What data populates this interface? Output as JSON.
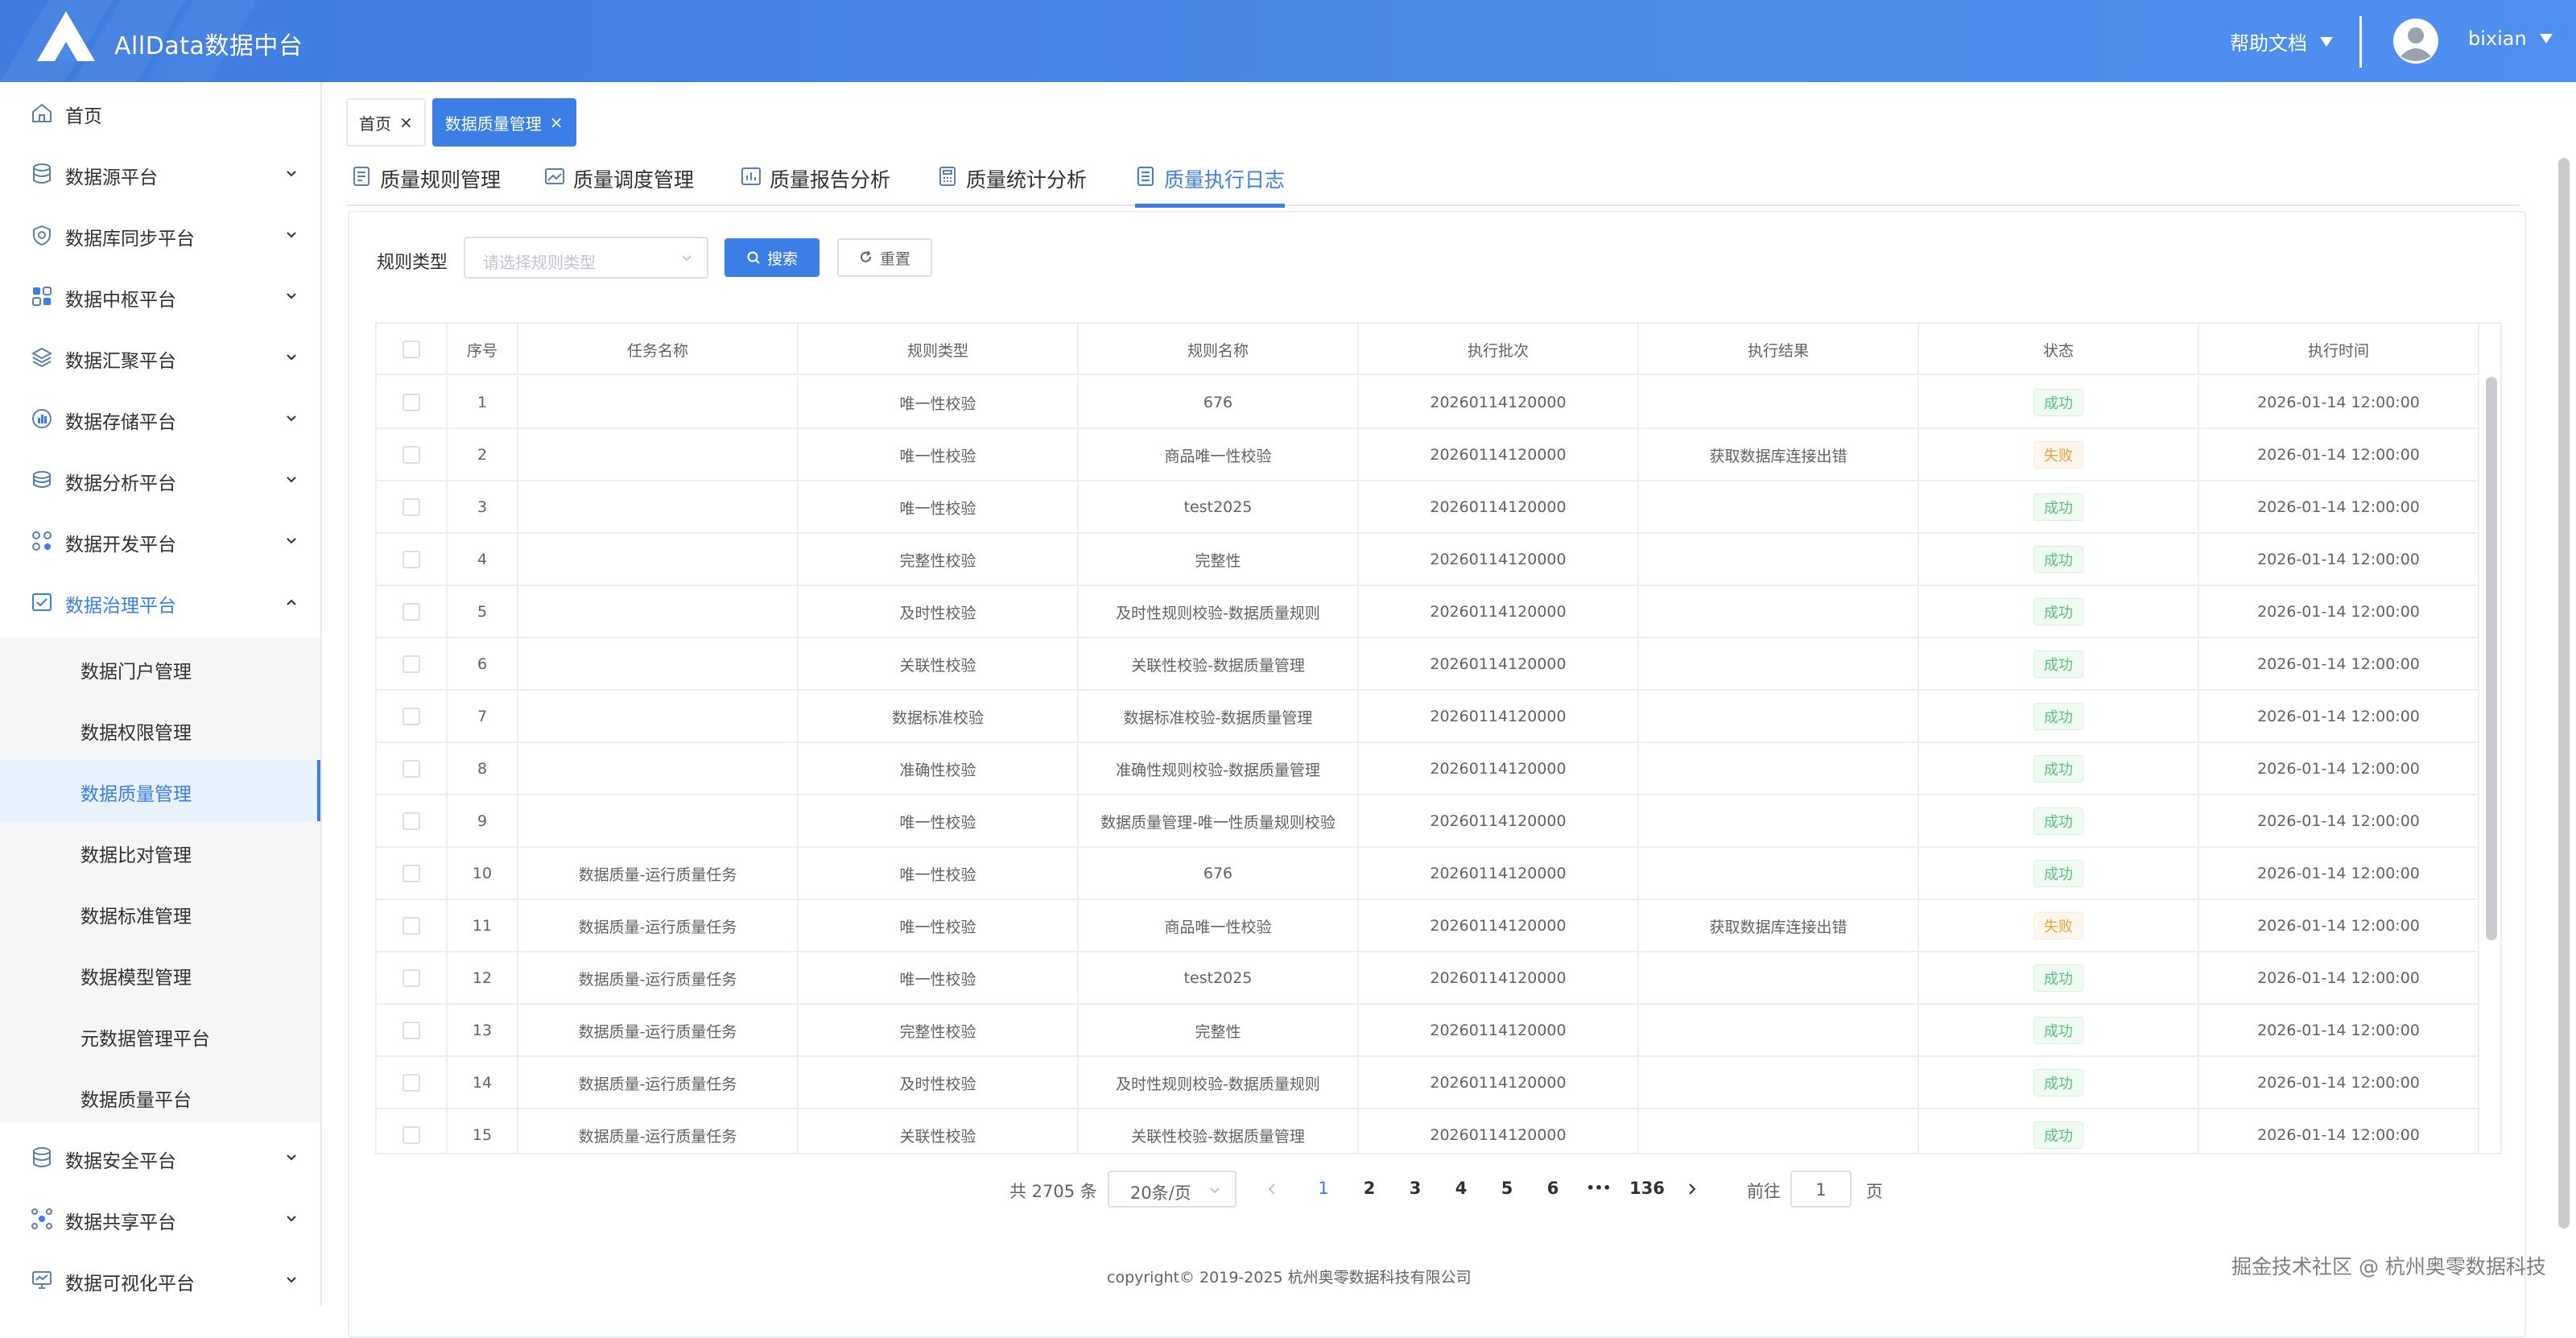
{
  "header": {
    "brand": "AllData数据中台",
    "help": "帮助文档",
    "username": "bixian"
  },
  "sidebar": {
    "items": [
      {
        "label": "首页",
        "icon": "home-icon"
      },
      {
        "label": "数据源平台",
        "icon": "database-icon"
      },
      {
        "label": "数据库同步平台",
        "icon": "sync-icon"
      },
      {
        "label": "数据中枢平台",
        "icon": "grid-icon"
      },
      {
        "label": "数据汇聚平台",
        "icon": "layers-icon"
      },
      {
        "label": "数据存储平台",
        "icon": "storage-chart-icon"
      },
      {
        "label": "数据分析平台",
        "icon": "analysis-icon"
      },
      {
        "label": "数据开发平台",
        "icon": "dev-nodes-icon"
      },
      {
        "label": "数据治理平台",
        "icon": "governance-icon"
      }
    ],
    "sub_items": [
      {
        "label": "数据门户管理"
      },
      {
        "label": "数据权限管理"
      },
      {
        "label": "数据质量管理"
      },
      {
        "label": "数据比对管理"
      },
      {
        "label": "数据标准管理"
      },
      {
        "label": "数据模型管理"
      },
      {
        "label": "元数据管理平台"
      },
      {
        "label": "数据质量平台"
      }
    ],
    "items_after": [
      {
        "label": "数据安全平台",
        "icon": "security-db-icon"
      },
      {
        "label": "数据共享平台",
        "icon": "share-icon"
      },
      {
        "label": "数据可视化平台",
        "icon": "monitor-icon"
      }
    ]
  },
  "tags": [
    {
      "label": "首页"
    },
    {
      "label": "数据质量管理"
    }
  ],
  "subtabs": [
    {
      "label": "质量规则管理"
    },
    {
      "label": "质量调度管理"
    },
    {
      "label": "质量报告分析"
    },
    {
      "label": "质量统计分析"
    },
    {
      "label": "质量执行日志"
    }
  ],
  "filter": {
    "label": "规则类型",
    "placeholder": "请选择规则类型",
    "search": "搜索",
    "reset": "重置"
  },
  "table": {
    "headers": [
      "序号",
      "任务名称",
      "规则类型",
      "规则名称",
      "执行批次",
      "执行结果",
      "状态",
      "执行时间"
    ],
    "rows": [
      {
        "no": "1",
        "task": "",
        "type": "唯一性校验",
        "name": "676",
        "batch": "20260114120000",
        "result": "",
        "status": "成功",
        "status_kind": "ok",
        "time": "2026-01-14 12:00:00"
      },
      {
        "no": "2",
        "task": "",
        "type": "唯一性校验",
        "name": "商品唯一性校验",
        "batch": "20260114120000",
        "result": "获取数据库连接出错",
        "status": "失败",
        "status_kind": "fail",
        "time": "2026-01-14 12:00:00"
      },
      {
        "no": "3",
        "task": "",
        "type": "唯一性校验",
        "name": "test2025",
        "batch": "20260114120000",
        "result": "",
        "status": "成功",
        "status_kind": "ok",
        "time": "2026-01-14 12:00:00"
      },
      {
        "no": "4",
        "task": "",
        "type": "完整性校验",
        "name": "完整性",
        "batch": "20260114120000",
        "result": "",
        "status": "成功",
        "status_kind": "ok",
        "time": "2026-01-14 12:00:00"
      },
      {
        "no": "5",
        "task": "",
        "type": "及时性校验",
        "name": "及时性规则校验-数据质量规则",
        "batch": "20260114120000",
        "result": "",
        "status": "成功",
        "status_kind": "ok",
        "time": "2026-01-14 12:00:00"
      },
      {
        "no": "6",
        "task": "",
        "type": "关联性校验",
        "name": "关联性校验-数据质量管理",
        "batch": "20260114120000",
        "result": "",
        "status": "成功",
        "status_kind": "ok",
        "time": "2026-01-14 12:00:00"
      },
      {
        "no": "7",
        "task": "",
        "type": "数据标准校验",
        "name": "数据标准校验-数据质量管理",
        "batch": "20260114120000",
        "result": "",
        "status": "成功",
        "status_kind": "ok",
        "time": "2026-01-14 12:00:00"
      },
      {
        "no": "8",
        "task": "",
        "type": "准确性校验",
        "name": "准确性规则校验-数据质量管理",
        "batch": "20260114120000",
        "result": "",
        "status": "成功",
        "status_kind": "ok",
        "time": "2026-01-14 12:00:00"
      },
      {
        "no": "9",
        "task": "",
        "type": "唯一性校验",
        "name": "数据质量管理-唯一性质量规则校验",
        "batch": "20260114120000",
        "result": "",
        "status": "成功",
        "status_kind": "ok",
        "time": "2026-01-14 12:00:00"
      },
      {
        "no": "10",
        "task": "数据质量-运行质量任务",
        "type": "唯一性校验",
        "name": "676",
        "batch": "20260114120000",
        "result": "",
        "status": "成功",
        "status_kind": "ok",
        "time": "2026-01-14 12:00:00"
      },
      {
        "no": "11",
        "task": "数据质量-运行质量任务",
        "type": "唯一性校验",
        "name": "商品唯一性校验",
        "batch": "20260114120000",
        "result": "获取数据库连接出错",
        "status": "失败",
        "status_kind": "fail",
        "time": "2026-01-14 12:00:00"
      },
      {
        "no": "12",
        "task": "数据质量-运行质量任务",
        "type": "唯一性校验",
        "name": "test2025",
        "batch": "20260114120000",
        "result": "",
        "status": "成功",
        "status_kind": "ok",
        "time": "2026-01-14 12:00:00"
      },
      {
        "no": "13",
        "task": "数据质量-运行质量任务",
        "type": "完整性校验",
        "name": "完整性",
        "batch": "20260114120000",
        "result": "",
        "status": "成功",
        "status_kind": "ok",
        "time": "2026-01-14 12:00:00"
      },
      {
        "no": "14",
        "task": "数据质量-运行质量任务",
        "type": "及时性校验",
        "name": "及时性规则校验-数据质量规则",
        "batch": "20260114120000",
        "result": "",
        "status": "成功",
        "status_kind": "ok",
        "time": "2026-01-14 12:00:00"
      },
      {
        "no": "15",
        "task": "数据质量-运行质量任务",
        "type": "关联性校验",
        "name": "关联性校验-数据质量管理",
        "batch": "20260114120000",
        "result": "",
        "status": "成功",
        "status_kind": "ok",
        "time": "2026-01-14 12:00:00"
      }
    ]
  },
  "pagination": {
    "total": "共 2705 条",
    "page_size": "20条/页",
    "pages": [
      "1",
      "2",
      "3",
      "4",
      "5",
      "6"
    ],
    "ellipsis": "•••",
    "last": "136",
    "goto_label": "前往",
    "goto_value": "1",
    "goto_suffix": "页"
  },
  "footer": "copyright© 2019-2025 杭州奥零数据科技有限公司",
  "watermark": "掘金技术社区 @ 杭州奥零数据科技",
  "colors": {
    "accent": "#3a7ee6",
    "header": "#4a8ae8",
    "success": "#58c27d",
    "warning": "#e6a23c"
  }
}
